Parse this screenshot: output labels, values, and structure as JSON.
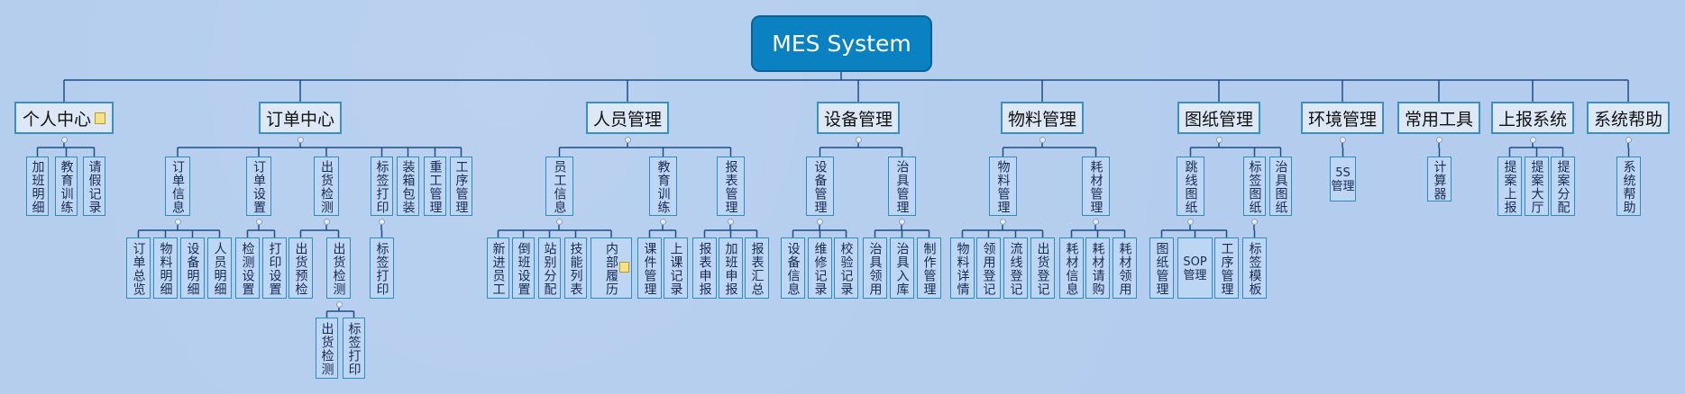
{
  "root": {
    "label": "MES System"
  },
  "branches": [
    {
      "id": "b1",
      "label": "个人中心",
      "note": true,
      "children": [
        {
          "label": "加班明细"
        },
        {
          "label": "教育训练"
        },
        {
          "label": "请假记录"
        }
      ]
    },
    {
      "id": "b2",
      "label": "订单中心",
      "children": [
        {
          "label": "订单信息",
          "children": [
            {
              "label": "订单总览"
            },
            {
              "label": "物料明细"
            },
            {
              "label": "设备明细"
            },
            {
              "label": "人员明细"
            }
          ]
        },
        {
          "label": "订单设置",
          "children": [
            {
              "label": "检测设置"
            },
            {
              "label": "打印设置"
            }
          ]
        },
        {
          "label": "出货检测",
          "children": [
            {
              "label": "出货预检"
            },
            {
              "label": "出货检测",
              "children": [
                {
                  "label": "出货检测"
                },
                {
                  "label": "标签打印"
                }
              ]
            }
          ]
        },
        {
          "label": "标签打印",
          "children": [
            {
              "label": "标签打印"
            }
          ]
        },
        {
          "label": "装箱包装"
        },
        {
          "label": "重工管理"
        },
        {
          "label": "工序管理"
        }
      ]
    },
    {
      "id": "b3",
      "label": "人员管理",
      "children": [
        {
          "label": "员工信息",
          "children": [
            {
              "label": "新进员工"
            },
            {
              "label": "倒班设置"
            },
            {
              "label": "站别分配"
            },
            {
              "label": "技能列表"
            },
            {
              "label": "内部履历",
              "note": true
            }
          ]
        },
        {
          "label": "教育训练",
          "children": [
            {
              "label": "课件管理"
            },
            {
              "label": "上课记录"
            }
          ]
        },
        {
          "label": "报表管理",
          "children": [
            {
              "label": "报表申报"
            },
            {
              "label": "加班申报"
            },
            {
              "label": "报表汇总"
            }
          ]
        }
      ]
    },
    {
      "id": "b4",
      "label": "设备管理",
      "children": [
        {
          "label": "设备管理",
          "children": [
            {
              "label": "设备信息"
            },
            {
              "label": "维修记录"
            },
            {
              "label": "校验记录"
            }
          ]
        },
        {
          "label": "治具管理",
          "children": [
            {
              "label": "治具领用"
            },
            {
              "label": "治具入库"
            },
            {
              "label": "制作管理"
            }
          ]
        }
      ]
    },
    {
      "id": "b5",
      "label": "物料管理",
      "children": [
        {
          "label": "物料管理",
          "children": [
            {
              "label": "物料详情"
            },
            {
              "label": "领用登记"
            },
            {
              "label": "流线登记"
            },
            {
              "label": "出货登记"
            }
          ]
        },
        {
          "label": "耗材管理",
          "children": [
            {
              "label": "耗材信息"
            },
            {
              "label": "耗材请购"
            },
            {
              "label": "耗材领用"
            }
          ]
        }
      ]
    },
    {
      "id": "b6",
      "label": "图纸管理",
      "children": [
        {
          "label": "跳线图纸",
          "children": [
            {
              "label": "图纸管理"
            },
            {
              "label": "SOP管理"
            },
            {
              "label": "工序管理"
            }
          ]
        },
        {
          "label": "标签图纸",
          "children": [
            {
              "label": "标签模板"
            }
          ]
        },
        {
          "label": "治具图纸"
        }
      ]
    },
    {
      "id": "b7",
      "label": "环境管理",
      "children": [
        {
          "label": "5S管理"
        }
      ]
    },
    {
      "id": "b8",
      "label": "常用工具",
      "children": [
        {
          "label": "计算器"
        }
      ]
    },
    {
      "id": "b9",
      "label": "上报系统",
      "children": [
        {
          "label": "提案上报"
        },
        {
          "label": "提案大厅"
        },
        {
          "label": "提案分配"
        }
      ]
    },
    {
      "id": "b10",
      "label": "系统帮助",
      "children": [
        {
          "label": "系统帮助"
        }
      ]
    }
  ]
}
